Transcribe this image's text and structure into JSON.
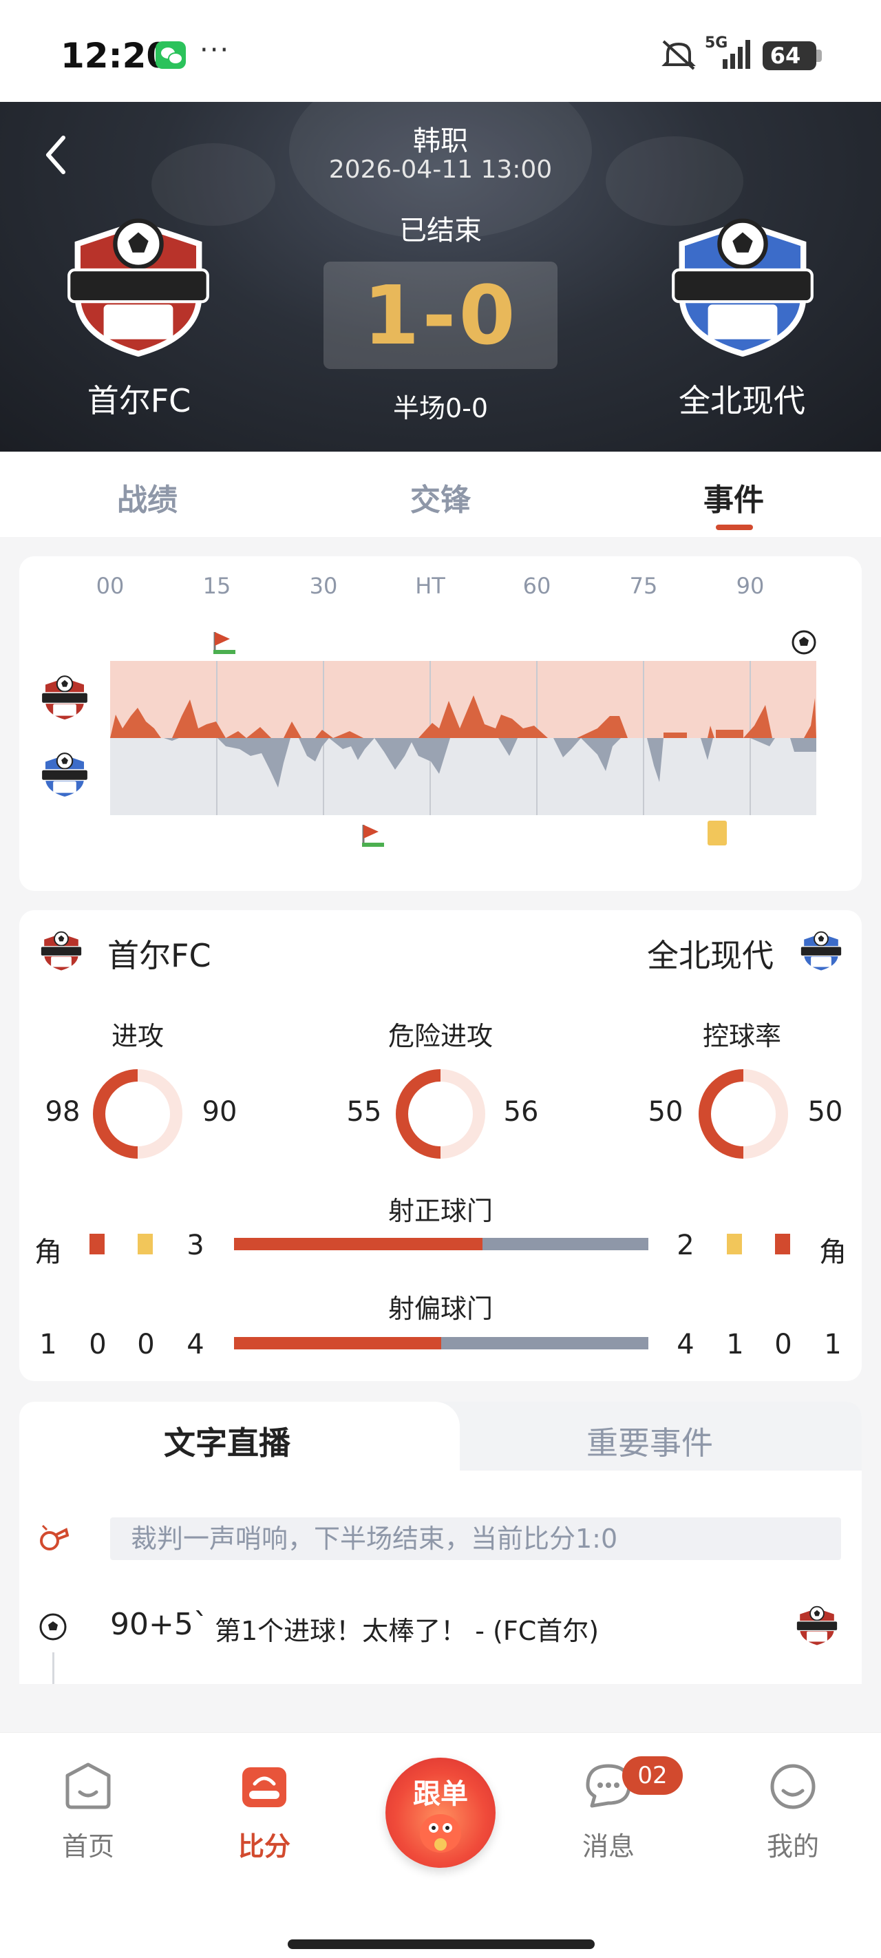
{
  "status_bar": {
    "time": "12:20",
    "dots": "···",
    "network": "5G",
    "battery": "64"
  },
  "match": {
    "league": "韩职",
    "datetime": "2026-04-11 13:00",
    "status": "已结束",
    "score": "1-0",
    "half_time": "半场0-0",
    "home_team": "首尔FC",
    "away_team": "全北现代"
  },
  "tabs": [
    {
      "label": "战绩",
      "active": false
    },
    {
      "label": "交锋",
      "active": false
    },
    {
      "label": "事件",
      "active": true
    }
  ],
  "timeline": {
    "ticks": [
      "00",
      "15",
      "30",
      "HT",
      "60",
      "75",
      "90"
    ],
    "icons": {
      "home_events": [
        "corner-flag-icon",
        "goal-ball-icon"
      ],
      "away_events": [
        "corner-flag-icon",
        "yellow-card-icon"
      ]
    }
  },
  "stats": {
    "home_team": "首尔FC",
    "away_team": "全北现代",
    "rings": [
      {
        "title": "进攻",
        "home": "98",
        "away": "90"
      },
      {
        "title": "危险进攻",
        "home": "55",
        "away": "56"
      },
      {
        "title": "控球率",
        "home": "50",
        "away": "50"
      }
    ],
    "shots_on": {
      "title": "射正球门",
      "home_corner_label": "角",
      "away_corner_label": "角",
      "home": "3",
      "away": "2",
      "home_fraction": 0.6
    },
    "shots_off": {
      "title": "射偏球门",
      "home_row": [
        "1",
        "0",
        "0",
        "4"
      ],
      "away_row": [
        "4",
        "1",
        "0",
        "1"
      ],
      "home_fraction": 0.5
    }
  },
  "live": {
    "tabs": {
      "active": "文字直播",
      "inactive": "重要事件"
    },
    "note": "裁判一声哨响，下半场结束，当前比分1:0",
    "event": {
      "minute": "90+5`",
      "text": "第1个进球！太棒了！ - (FC首尔)"
    }
  },
  "nav": {
    "items": [
      {
        "label": "首页",
        "active": false
      },
      {
        "label": "比分",
        "active": true
      },
      {
        "label": "消息",
        "active": false
      },
      {
        "label": "我的",
        "active": false
      }
    ],
    "follow_label": "跟单",
    "badge": "02"
  },
  "colors": {
    "accent": "#d24a2e",
    "score": "#e8b85a",
    "grey_bar": "#8e97a8",
    "yellow_card": "#f2c65a"
  }
}
